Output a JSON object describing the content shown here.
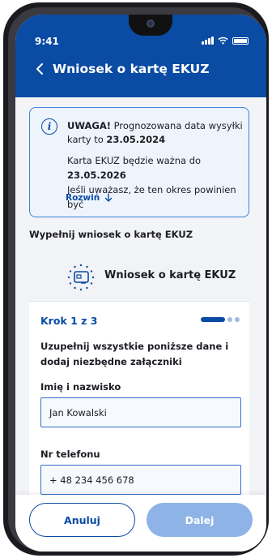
{
  "status_bar": {
    "time": "9:41"
  },
  "header": {
    "title": "Wniosek o kartę EKUZ"
  },
  "notice": {
    "bold_prefix": "UWAGA!",
    "text1": " Prognozowana data wysyłki karty to ",
    "date1": "23.05.2024",
    "text2": "Karta EKUZ będzie ważna do ",
    "date2": "23.05.2026",
    "text3": "Jeśli uważasz, że ten okres powinien być",
    "expand_label": "Rozwiń",
    "info_icon_glyph": "i"
  },
  "section_label": "Wypełnij wniosek o kartę EKUZ",
  "card": {
    "title": "Wniosek o kartę EKUZ",
    "step_label": "Krok 1 z 3",
    "step_current": 1,
    "step_total": 3,
    "instructions": "Uzupełnij wszystkie poniższe dane i dodaj niezbędne załączniki",
    "fields": [
      {
        "label": "Imię i nazwisko",
        "value": "Jan Kowalski"
      },
      {
        "label": "Nr telefonu",
        "value": "+ 48 234 456 678"
      }
    ]
  },
  "actions": {
    "cancel_label": "Anuluj",
    "next_label": "Dalej"
  },
  "colors": {
    "brand": "#0a4ba3",
    "notice_border": "#3f7fd6",
    "next_disabled": "#8eb3e6",
    "background": "#f3f4f7"
  },
  "icons": [
    "back-arrow-icon",
    "info-icon",
    "arrow-down-icon",
    "eu-card-icon",
    "signal-icon",
    "wifi-icon",
    "battery-icon"
  ]
}
